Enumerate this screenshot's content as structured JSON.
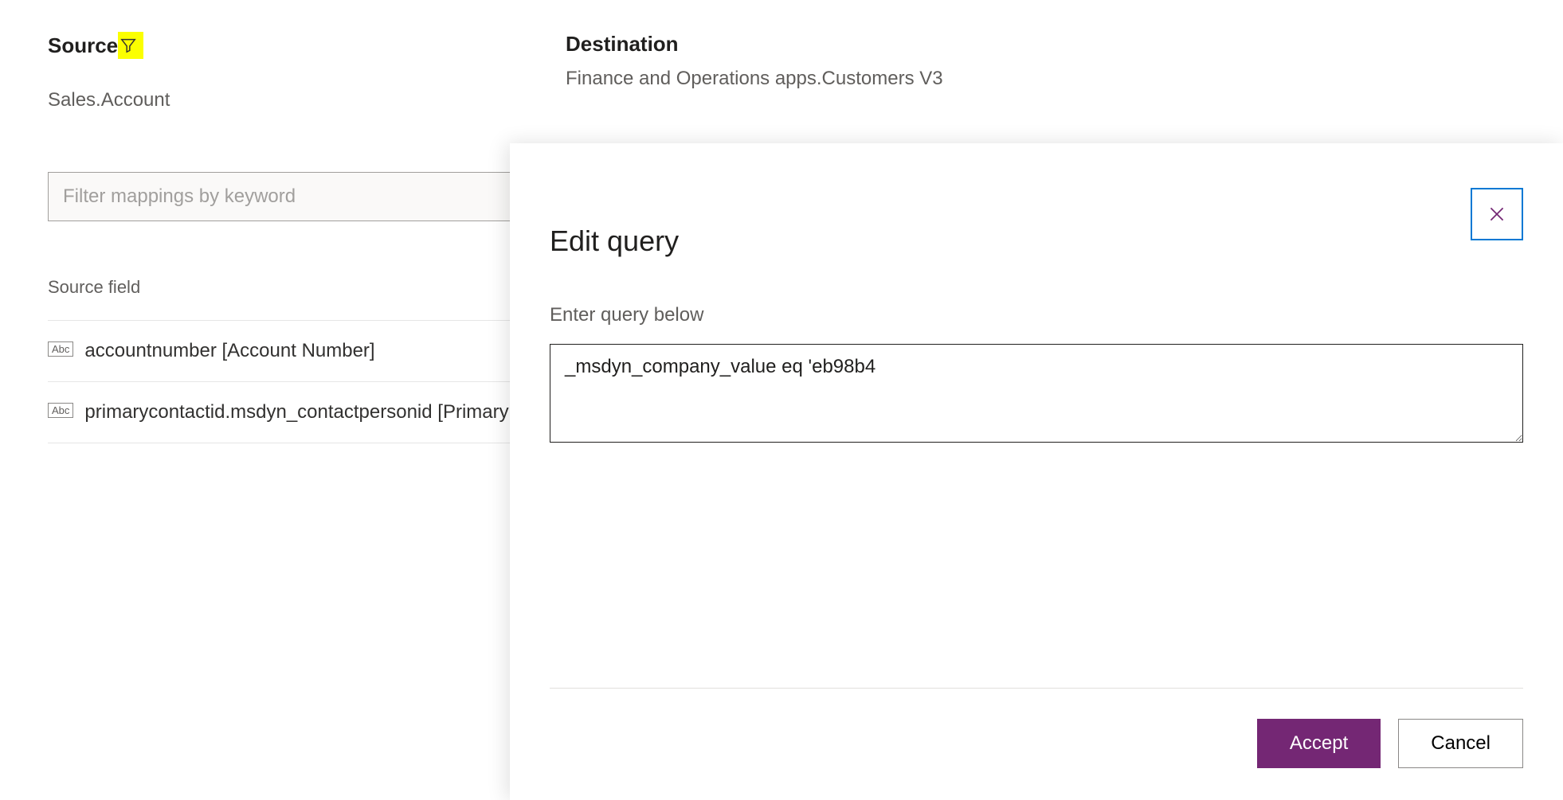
{
  "source": {
    "title": "Source",
    "value": "Sales.Account"
  },
  "destination": {
    "title": "Destination",
    "value": "Finance and Operations apps.Customers V3"
  },
  "filter": {
    "placeholder": "Filter mappings by keyword"
  },
  "columns": {
    "source_field": "Source field"
  },
  "rows": [
    {
      "badge": "Abc",
      "text": "accountnumber [Account Number]"
    },
    {
      "badge": "Abc",
      "text": "primarycontactid.msdyn_contactpersonid [Primary Contact (Account Number/Contact Person ID)]"
    }
  ],
  "dialog": {
    "title": "Edit query",
    "subtitle": "Enter query below",
    "value": "_msdyn_company_value eq 'eb98b4",
    "accept": "Accept",
    "cancel": "Cancel"
  }
}
